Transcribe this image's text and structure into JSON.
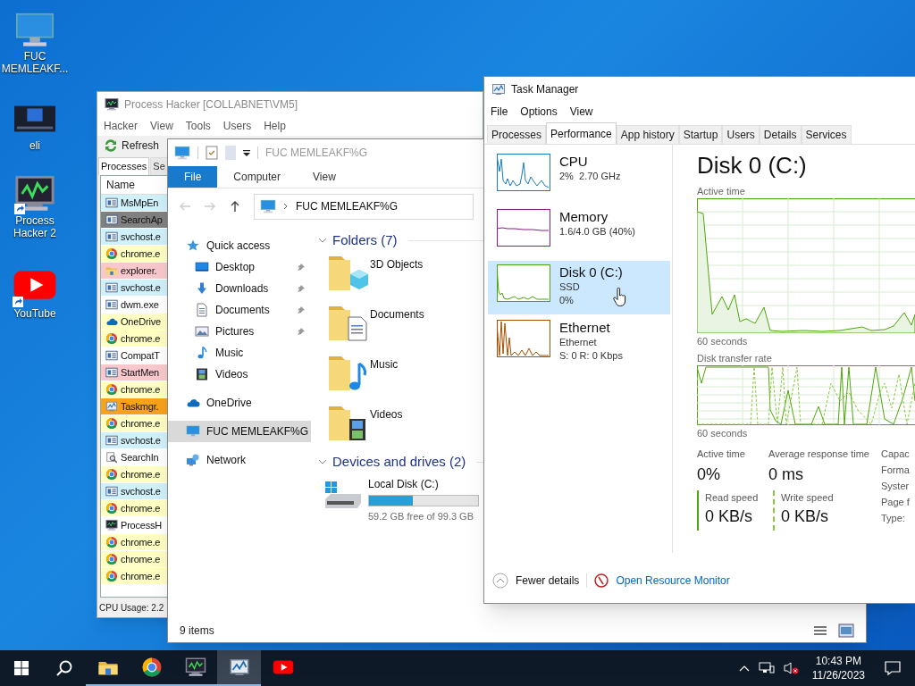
{
  "desktop": {
    "icons": [
      {
        "label": "FUC MEMLEAKF...",
        "kind": "computer",
        "shortcut": false
      },
      {
        "label": "eli",
        "kind": "screen",
        "shortcut": false
      },
      {
        "label": "Process Hacker 2",
        "kind": "hacker",
        "shortcut": true
      },
      {
        "label": "YouTube",
        "kind": "youtube",
        "shortcut": true
      }
    ]
  },
  "process_hacker": {
    "title": "Process Hacker [COLLABNET\\VM5]",
    "menu": [
      "Hacker",
      "View",
      "Tools",
      "Users",
      "Help"
    ],
    "toolbar": [
      "Refresh"
    ],
    "tabs": [
      {
        "label": "Processes",
        "selected": true
      },
      {
        "label": "Se",
        "selected": false
      }
    ],
    "column": "Name",
    "rows": [
      {
        "name": "MsMpEn",
        "kind": "app",
        "color": "#d0f0fa"
      },
      {
        "name": "SearchAp",
        "kind": "app",
        "color": "#808080"
      },
      {
        "name": "svchost.e",
        "kind": "app",
        "color": "#d0f0fa"
      },
      {
        "name": "chrome.e",
        "kind": "ring",
        "color": "#ffffc4"
      },
      {
        "name": "explorer.",
        "kind": "folder",
        "color": "#f8c8cc"
      },
      {
        "name": "svchost.e",
        "kind": "app",
        "color": "#d0f0fa"
      },
      {
        "name": "dwm.exe",
        "kind": "app",
        "color": "#ffffff"
      },
      {
        "name": "OneDrive",
        "kind": "cloud",
        "color": "#ffffc4"
      },
      {
        "name": "chrome.e",
        "kind": "ring",
        "color": "#ffffc4"
      },
      {
        "name": "CompatT",
        "kind": "app",
        "color": "#ffffff"
      },
      {
        "name": "StartMen",
        "kind": "app",
        "color": "#f8c8cc"
      },
      {
        "name": "chrome.e",
        "kind": "ring",
        "color": "#ffffc4"
      },
      {
        "name": "Taskmgr.",
        "kind": "chart",
        "color": "#f7a21b"
      },
      {
        "name": "chrome.e",
        "kind": "ring",
        "color": "#ffffc4"
      },
      {
        "name": "svchost.e",
        "kind": "app",
        "color": "#d0f0fa"
      },
      {
        "name": "SearchIn",
        "kind": "search",
        "color": "#ffffff"
      },
      {
        "name": "chrome.e",
        "kind": "ring",
        "color": "#ffffc4"
      },
      {
        "name": "svchost.e",
        "kind": "app",
        "color": "#d0f0fa"
      },
      {
        "name": "chrome.e",
        "kind": "ring",
        "color": "#ffffc4"
      },
      {
        "name": "ProcessH",
        "kind": "hacker",
        "color": "#ffffff"
      },
      {
        "name": "chrome.e",
        "kind": "ring",
        "color": "#ffffc4"
      },
      {
        "name": "chrome.e",
        "kind": "ring",
        "color": "#ffffc4"
      },
      {
        "name": "chrome.e",
        "kind": "ring",
        "color": "#ffffc4"
      }
    ],
    "status": "CPU Usage: 2.2"
  },
  "explorer": {
    "title": "FUC MEMLEAKF%G",
    "ribbon_tabs": [
      {
        "label": "File",
        "selected": true
      },
      {
        "label": "Computer",
        "selected": false
      },
      {
        "label": "View",
        "selected": false
      }
    ],
    "address": "FUC MEMLEAKF%G",
    "nav": [
      {
        "label": "Quick access",
        "kind": "star",
        "selected": false,
        "children": [
          {
            "label": "Desktop",
            "kind": "desktop",
            "pinned": true,
            "selected": false
          },
          {
            "label": "Downloads",
            "kind": "download",
            "pinned": true,
            "selected": false
          },
          {
            "label": "Documents",
            "kind": "document",
            "pinned": true,
            "selected": false
          },
          {
            "label": "Pictures",
            "kind": "picture",
            "pinned": true,
            "selected": false
          },
          {
            "label": "Music",
            "kind": "music",
            "pinned": false,
            "selected": false
          },
          {
            "label": "Videos",
            "kind": "video",
            "pinned": false,
            "selected": false
          }
        ]
      },
      {
        "label": "OneDrive",
        "kind": "cloud",
        "selected": false
      },
      {
        "label": "FUC MEMLEAKF%G",
        "kind": "computer",
        "selected": true
      },
      {
        "label": "Network",
        "kind": "network",
        "selected": false
      }
    ],
    "groups": [
      {
        "title": "Folders (7)",
        "items": [
          {
            "label": "3D Objects",
            "kind": "cube"
          },
          {
            "label": "Documents",
            "kind": "document"
          },
          {
            "label": "Music",
            "kind": "music"
          },
          {
            "label": "Videos",
            "kind": "video"
          }
        ]
      },
      {
        "title": "Devices and drives (2)",
        "items": [
          {
            "label": "Local Disk (C:)",
            "kind": "drive",
            "level": 0.4,
            "detail": "59.2 GB free of 99.3 GB"
          }
        ]
      }
    ],
    "status": "9 items"
  },
  "task_manager": {
    "title": "Task Manager",
    "menu": [
      "File",
      "Options",
      "View"
    ],
    "tabs": [
      {
        "label": "Processes",
        "selected": false
      },
      {
        "label": "Performance",
        "selected": true
      },
      {
        "label": "App history",
        "selected": false
      },
      {
        "label": "Startup",
        "selected": false
      },
      {
        "label": "Users",
        "selected": false
      },
      {
        "label": "Details",
        "selected": false
      },
      {
        "label": "Services",
        "selected": false
      }
    ],
    "resources": [
      {
        "name": "CPU",
        "lines": [
          "2%  2.70 GHz"
        ],
        "kind": "cpu",
        "color": "#1a7bb8",
        "selected": false
      },
      {
        "name": "Memory",
        "lines": [
          "1.6/4.0 GB (40%)"
        ],
        "kind": "memory",
        "color": "#8b1a8b",
        "selected": false
      },
      {
        "name": "Disk 0 (C:)",
        "lines": [
          "SSD",
          "0%"
        ],
        "kind": "disk",
        "color": "#4da60c",
        "selected": true
      },
      {
        "name": "Ethernet",
        "lines": [
          "Ethernet",
          "S: 0 R: 0 Kbps"
        ],
        "kind": "ethernet",
        "color": "#a74f01",
        "selected": false
      }
    ],
    "heading": "Disk 0 (C:)",
    "graphs": [
      {
        "label": "Active time",
        "caption": "60 seconds",
        "kind": "active"
      },
      {
        "label": "Disk transfer rate",
        "caption": "60 seconds",
        "kind": "transfer"
      }
    ],
    "stats": [
      {
        "label": "Active time",
        "value": "0%"
      },
      {
        "label": "Average response time",
        "value": "0 ms"
      }
    ],
    "speeds": [
      {
        "label": "Read speed",
        "value": "0 KB/s",
        "kind": "solid"
      },
      {
        "label": "Write speed",
        "value": "0 KB/s",
        "kind": "dashed"
      }
    ],
    "properties": [
      "Capac",
      "Forma",
      "Syster",
      "Page f",
      "Type:"
    ],
    "footer": {
      "toggle": "Fewer details",
      "link": "Open Resource Monitor"
    }
  },
  "taskbar": {
    "apps": [
      {
        "kind": "explorer",
        "running": true,
        "selected": false
      },
      {
        "kind": "chrome",
        "running": true,
        "selected": false
      },
      {
        "kind": "hacker",
        "running": true,
        "selected": false
      },
      {
        "kind": "taskmgr",
        "running": true,
        "selected": true
      },
      {
        "kind": "youtube",
        "running": false,
        "selected": false
      }
    ],
    "time": "10:43 PM",
    "date": "11/26/2023"
  }
}
